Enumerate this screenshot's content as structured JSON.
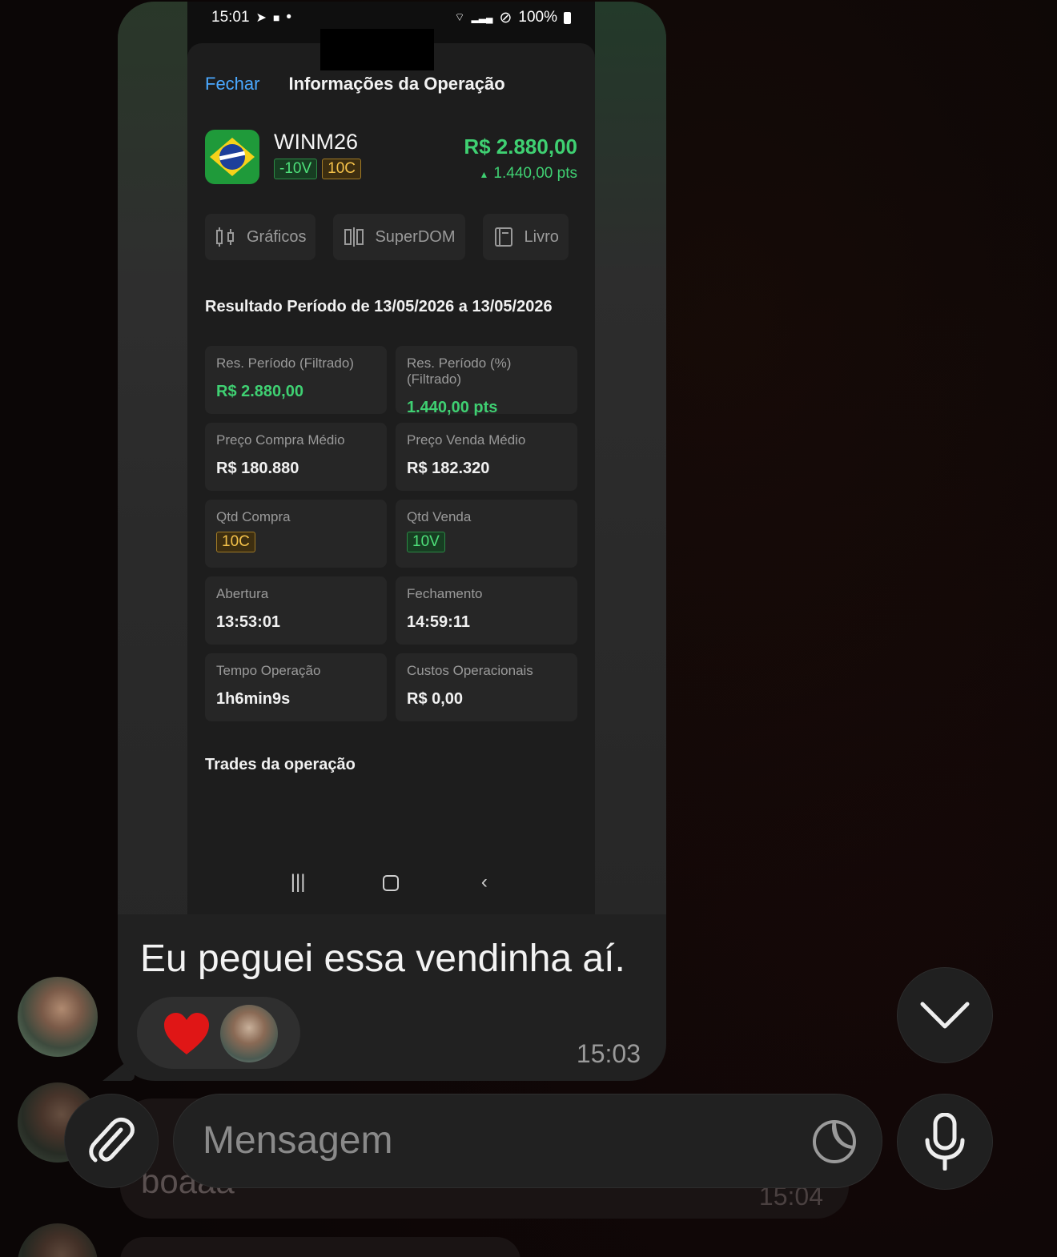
{
  "phone": {
    "status": {
      "time": "15:01",
      "battery": "100%"
    },
    "header": {
      "close_label": "Fechar",
      "title": "Informações da Operação"
    },
    "asset": {
      "ticker": "WINM26",
      "sell_tag": "-10V",
      "buy_tag": "10C",
      "result_value": "R$ 2.880,00",
      "result_points": "1.440,00 pts"
    },
    "buttons": [
      {
        "label": "Gráficos",
        "icon": "candlestick-chart-icon"
      },
      {
        "label": "SuperDOM",
        "icon": "superdom-icon"
      },
      {
        "label": "Livro",
        "icon": "book-icon"
      }
    ],
    "period_title": "Resultado Período de 13/05/2026 a 13/05/2026",
    "cards": [
      {
        "label": "Res. Período (Filtrado)",
        "value": "R$ 2.880,00",
        "style": "green"
      },
      {
        "label": "Res. Período (%) (Filtrado)",
        "value": "1.440,00 pts",
        "style": "green"
      },
      {
        "label": "Preço Compra Médio",
        "value": "R$ 180.880",
        "style": "plain"
      },
      {
        "label": "Preço Venda Médio",
        "value": "R$ 182.320",
        "style": "plain"
      },
      {
        "label": "Qtd Compra",
        "value": "10C",
        "style": "gold-tag"
      },
      {
        "label": "Qtd Venda",
        "value": "10V",
        "style": "green-tag"
      },
      {
        "label": "Abertura",
        "value": "13:53:01",
        "style": "plain"
      },
      {
        "label": "Fechamento",
        "value": "14:59:11",
        "style": "plain"
      },
      {
        "label": "Tempo Operação",
        "value": "1h6min9s",
        "style": "plain"
      },
      {
        "label": "Custos Operacionais",
        "value": "R$ 0,00",
        "style": "plain"
      }
    ],
    "trades_title": "Trades da operação"
  },
  "message": {
    "caption": "Eu peguei essa vendinha aí.",
    "time": "15:03",
    "reaction": "heart"
  },
  "next_message": {
    "text": "boaaa",
    "time": "15:04"
  },
  "composer": {
    "placeholder": "Mensagem"
  },
  "colors": {
    "green": "#3fd072",
    "link": "#4aa8ff",
    "gold": "#f5c24a",
    "bubble": "#212121"
  }
}
